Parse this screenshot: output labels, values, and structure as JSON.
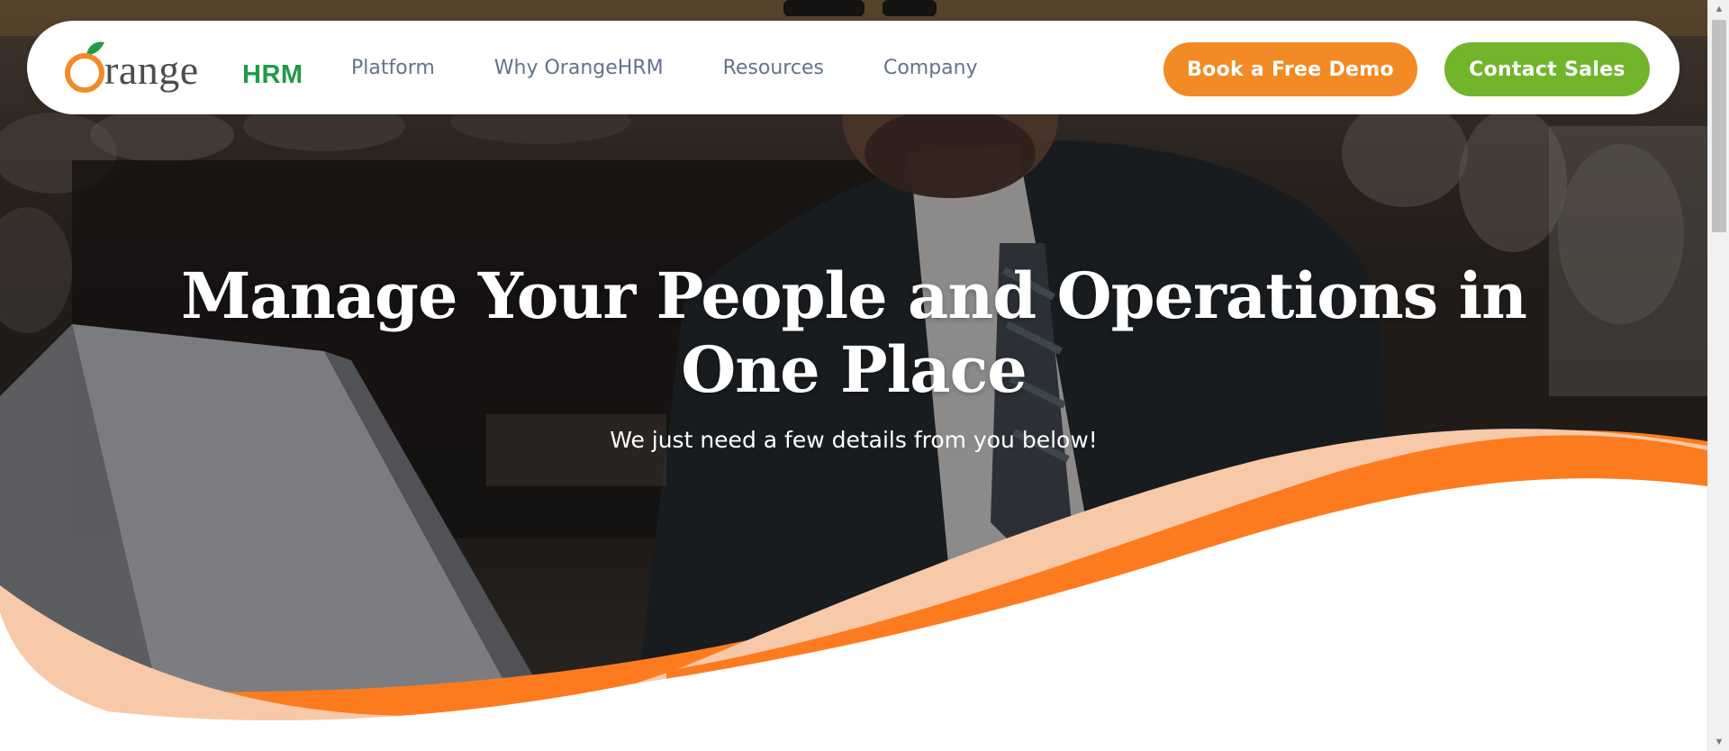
{
  "logo": {
    "wordmark": "range",
    "suffix": "HRM",
    "brand_orange": "#f28a25",
    "brand_green": "#1f9a46"
  },
  "nav": {
    "items": [
      {
        "label": "Platform"
      },
      {
        "label": "Why OrangeHRM"
      },
      {
        "label": "Resources"
      },
      {
        "label": "Company"
      }
    ]
  },
  "buttons": {
    "demo": {
      "label": "Book a Free Demo",
      "color": "#f28a25"
    },
    "sales": {
      "label": "Contact Sales",
      "color": "#72b52a"
    }
  },
  "hero": {
    "title": "Manage Your People and Operations in One Place",
    "subtitle": "We just need a few details from you below!"
  },
  "colors": {
    "wave_orange": "#fd7b1f",
    "wave_peach": "#f8c9a8",
    "nav_text": "#64728c"
  },
  "icons": {
    "logo_mark": "orange-fruit-icon",
    "scroll_up": "triangle-up-icon",
    "scroll_down": "triangle-down-icon"
  }
}
